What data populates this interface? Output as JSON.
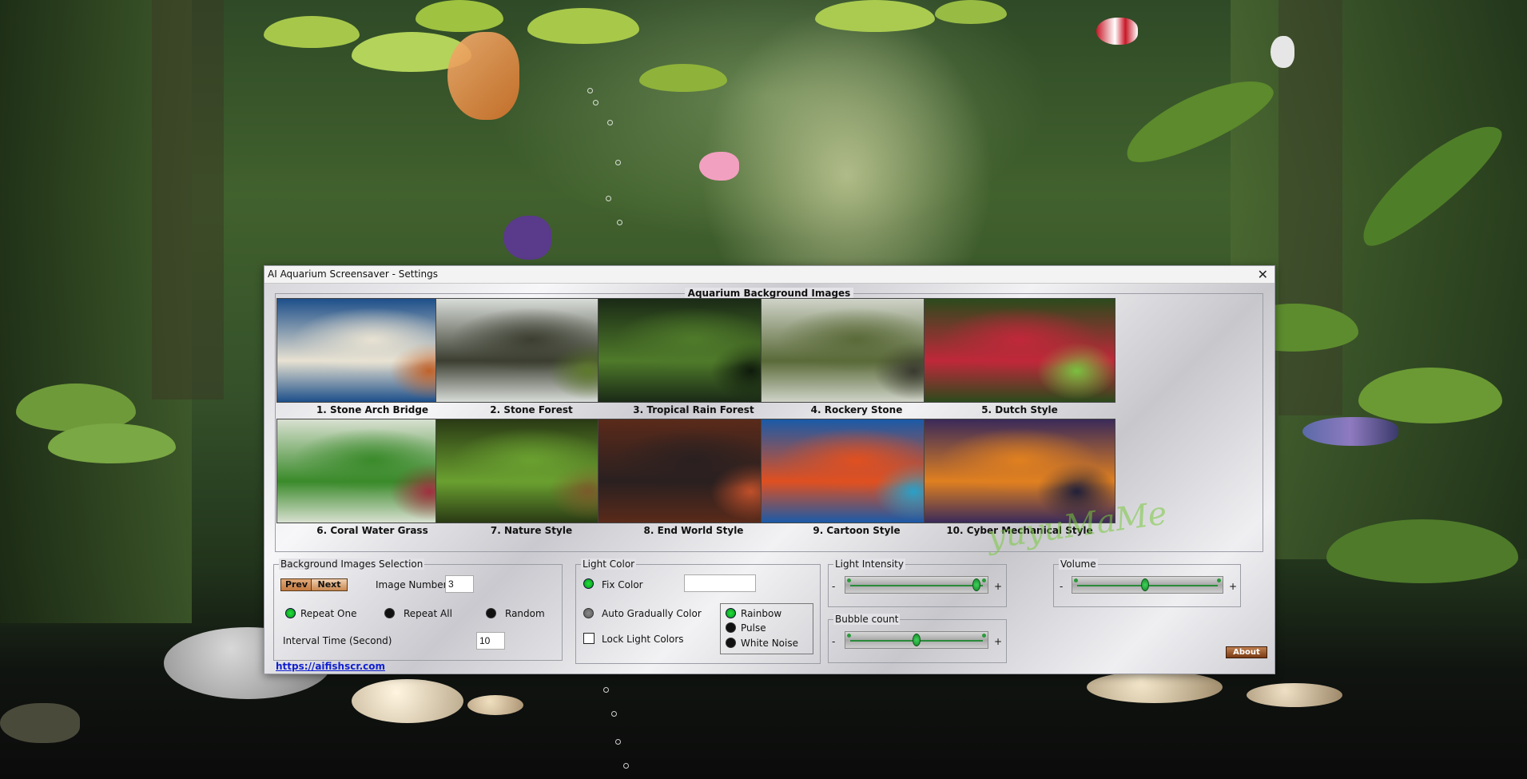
{
  "window": {
    "title": "AI Aquarium Screensaver - Settings",
    "close_glyph": "✕"
  },
  "gallery": {
    "title": "Aquarium Background Images",
    "items": [
      {
        "label": "1. Stone Arch Bridge",
        "colors": [
          "#1d4f8a",
          "#e8e2d2",
          "#c0622a"
        ]
      },
      {
        "label": "2. Stone Forest",
        "colors": [
          "#d8dcd8",
          "#3b3e30",
          "#5e7a2c"
        ]
      },
      {
        "label": "3. Tropical Rain Forest",
        "colors": [
          "#1a2a16",
          "#4f7a2a",
          "#0e1a0c"
        ]
      },
      {
        "label": "4. Rockery Stone",
        "colors": [
          "#cfd3c8",
          "#5a6a38",
          "#3a3a30"
        ]
      },
      {
        "label": "5. Dutch Style",
        "colors": [
          "#2c4a1c",
          "#c0283a",
          "#7ac040"
        ]
      },
      {
        "label": "6. Coral Water Grass",
        "colors": [
          "#d8e0d0",
          "#3a8a2a",
          "#a03040"
        ]
      },
      {
        "label": "7. Nature Style",
        "colors": [
          "#2a3a14",
          "#6aa030",
          "#7a5a2a"
        ]
      },
      {
        "label": "8.  End  World Style",
        "colors": [
          "#5a2a1a",
          "#2a2020",
          "#c0502a"
        ]
      },
      {
        "label": "9. Cartoon Style",
        "colors": [
          "#1a5aa8",
          "#e05020",
          "#2aa0c8"
        ]
      },
      {
        "label": "10. Cyber Mechanical Style",
        "colors": [
          "#3a2a5a",
          "#e08020",
          "#20203a"
        ]
      }
    ]
  },
  "selection": {
    "title": "Background Images Selection",
    "prev_label": "Prev",
    "next_label": "Next",
    "image_number_label": "Image Number",
    "image_number_value": "3",
    "repeat_one": "Repeat One",
    "repeat_all": "Repeat All",
    "random": "Random",
    "interval_label": "Interval Time (Second)",
    "interval_value": "10"
  },
  "light_color": {
    "title": "Light Color",
    "fix_color": "Fix Color",
    "fix_color_value": "",
    "auto_gradual": "Auto Gradually Color",
    "lock_colors": "Lock Light Colors",
    "rainbow": "Rainbow",
    "pulse": "Pulse",
    "white_noise": "White Noise"
  },
  "light_intensity": {
    "title": "Light Intensity",
    "minus": "-",
    "plus": "+",
    "level": 0.97
  },
  "volume": {
    "title": "Volume",
    "minus": "-",
    "plus": "+",
    "level": 0.48
  },
  "bubble_count": {
    "title": "Bubble count",
    "minus": "-",
    "plus": "+",
    "level": 0.5
  },
  "about_label": "About",
  "website": "https://aifishscr.com",
  "watermark": "yuyuMaMe"
}
